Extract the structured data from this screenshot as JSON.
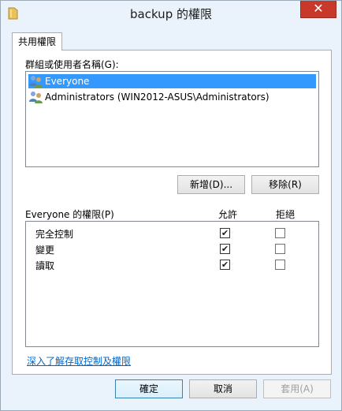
{
  "window": {
    "title": "backup 的權限",
    "close_label": "✕"
  },
  "tab": {
    "label": "共用權限"
  },
  "users": {
    "label": "群組或使用者名稱(G):",
    "items": [
      {
        "label": "Everyone",
        "selected": true
      },
      {
        "label": "Administrators (WIN2012-ASUS\\Administrators)",
        "selected": false
      }
    ],
    "add_label": "新增(D)...",
    "remove_label": "移除(R)"
  },
  "permissions": {
    "label": "Everyone 的權限(P)",
    "allow_header": "允許",
    "deny_header": "拒絕",
    "rows": [
      {
        "name": "完全控制",
        "allow": true,
        "deny": false
      },
      {
        "name": "變更",
        "allow": true,
        "deny": false
      },
      {
        "name": "讀取",
        "allow": true,
        "deny": false
      }
    ]
  },
  "link": {
    "label": "深入了解存取控制及權限"
  },
  "footer": {
    "ok_label": "確定",
    "cancel_label": "取消",
    "apply_label": "套用(A)"
  },
  "colors": {
    "selection": "#3399ff",
    "close": "#c8392b",
    "link": "#0066cc"
  }
}
